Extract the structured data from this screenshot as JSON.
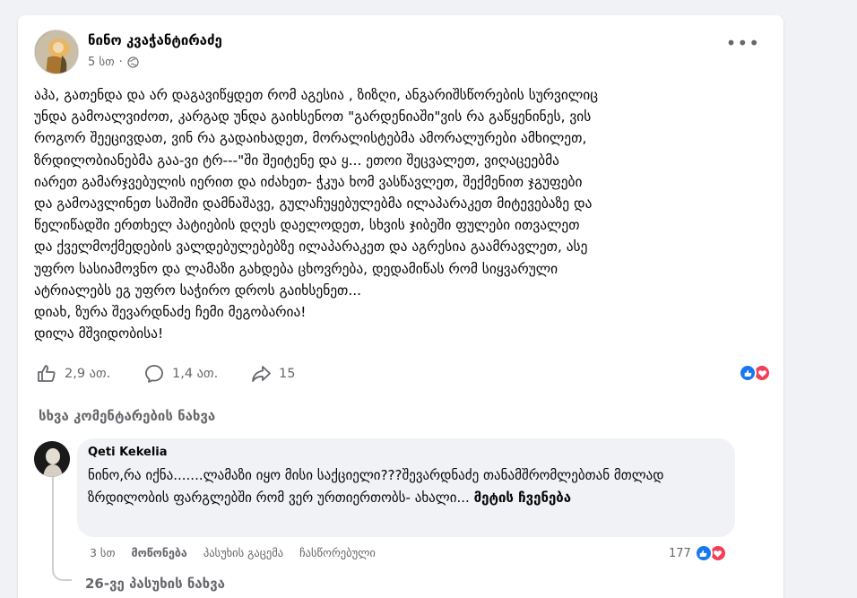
{
  "post": {
    "author": "ნინო კვაჭანტირაძე",
    "time": "5 სთ",
    "privacy_icon": "globe-icon",
    "more_icon": "more-horizontal-icon",
    "text": "აჰა, გათენდა და არ დაგავიწყდეთ რომ   აგესია , ზიზღი, ანგარიშსწორების სურვილიც\nუნდა გამოალვიძოთ, კარგად უნდა გაიხსენოთ  \"გარდენიაში\"ვის რა გაწყენინეს, ვის\nროგორ შეეცივდათ, ვინ რა გადაიხადეთ, მორალისტებმა ამორალურები ამხილეთ,\nზრდილობიანებმა გაა-ვი    ტრ---\"ში შეიტენე და  ყ... ეთოი  შეცვალეთ,  ვიღაცეებმა\nიარეთ  გამარჯვებულის იერით და იძახეთ- ჭკუა ხომ ვასწავლეთ,  შექმენით ჯგუფები\nდა  გამოავლინეთ საშიში დამნაშავე,  გულაჩუყებულებმა ილაპარაკეთ მიტევებაზე და\nწელიწადში ერთხელ პატიების დღეს დაელოდეთ, სხვის ჯიბეში ფულები ითვალეთ\nდა ქველმოქმედების ვალდებულებებზე ილაპარაკეთ და  აგრესია  გაამრავლეთ, ასე\nუფრო სასიამოვნო და ლამაზი გახდება ცხოვრება, დედამიწას რომ სიყვარული\nატრიალებს ეგ უფრო საჭირო დროს გაიხსენეთ...\nდიახ, ზურა შევარდნაძე ჩემი მეგობარია!\nდილა მშვიდობისა!",
    "likes": "2,9 ათ.",
    "comments": "1,4 ათ.",
    "shares": "15",
    "reaction_icons": [
      "like-icon",
      "love-icon"
    ]
  },
  "view_more_comments": "სხვა კომენტარების ნახვა",
  "comment": {
    "author": "Qeti Kekelia",
    "text": "ნინო,რა იქნა.......ლამაზი იყო მისი საქციელი???შევარდნაძე თანამშრომლებთან მთლად ზრდილობის ფარგლებში რომ ვერ ურთიერთობს- ახალი...",
    "see_more": "მეტის ჩვენება",
    "time": "3 სთ",
    "like_action": "მოწონება",
    "reply_action": "პასუხის გაცემა",
    "edited": "ჩასწორებული",
    "reaction_count": "177"
  },
  "replies_link": "26-ვე პასუხის ნახვა",
  "colors": {
    "like_blue": "#1877f2",
    "love_red": "#f33e58",
    "secondary_text": "#65676b"
  }
}
